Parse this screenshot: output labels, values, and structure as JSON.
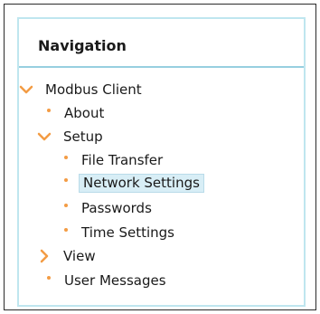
{
  "navigation": {
    "title": "Navigation",
    "accent_color": "#f39c44",
    "selected_bg": "#d8eef6",
    "items": {
      "modbus_client": {
        "label": "Modbus Client",
        "icon": "chevron-down-icon",
        "expanded": true
      },
      "about": {
        "label": "About"
      },
      "setup": {
        "label": "Setup",
        "icon": "chevron-down-icon",
        "expanded": true
      },
      "file_transfer": {
        "label": "File Transfer"
      },
      "network_settings": {
        "label": "Network Settings",
        "selected": true
      },
      "passwords": {
        "label": "Passwords"
      },
      "time_settings": {
        "label": "Time Settings"
      },
      "view": {
        "label": "View",
        "icon": "chevron-right-icon",
        "expanded": false
      },
      "user_messages": {
        "label": "User Messages"
      }
    }
  }
}
